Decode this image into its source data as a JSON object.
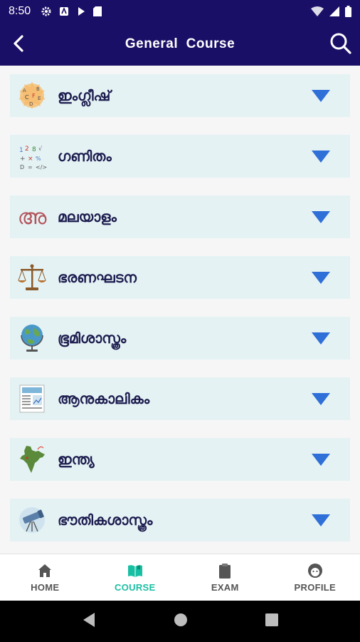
{
  "status_bar": {
    "time": "8:50"
  },
  "app_bar": {
    "title": "General  Course"
  },
  "subjects": [
    {
      "label": "ഇംഗ്ലീഷ്",
      "icon": "english-letters-icon"
    },
    {
      "label": "ഗണിതം",
      "icon": "math-icon"
    },
    {
      "label": "മലയാളം",
      "icon": "malayalam-letter-icon"
    },
    {
      "label": "ഭരണഘടന",
      "icon": "scales-icon"
    },
    {
      "label": "ഭൂമിശാസ്ത്രം",
      "icon": "globe-icon"
    },
    {
      "label": "ആനുകാലികം",
      "icon": "document-icon"
    },
    {
      "label": "ഇന്ത്യ",
      "icon": "india-map-icon"
    },
    {
      "label": "ഭൗതികശാസ്ത്രം",
      "icon": "telescope-icon"
    }
  ],
  "bottom_nav": [
    {
      "label": "HOME",
      "icon": "home-icon",
      "active": false
    },
    {
      "label": "COURSE",
      "icon": "book-icon",
      "active": true
    },
    {
      "label": "EXAM",
      "icon": "clipboard-icon",
      "active": false
    },
    {
      "label": "PROFILE",
      "icon": "profile-icon",
      "active": false
    }
  ],
  "colors": {
    "app_bar": "#1a0f66",
    "card_bg": "#e4f2f4",
    "chevron": "#2f6fd8",
    "active_nav": "#19bfa3"
  },
  "malayalam_letter": "അ"
}
